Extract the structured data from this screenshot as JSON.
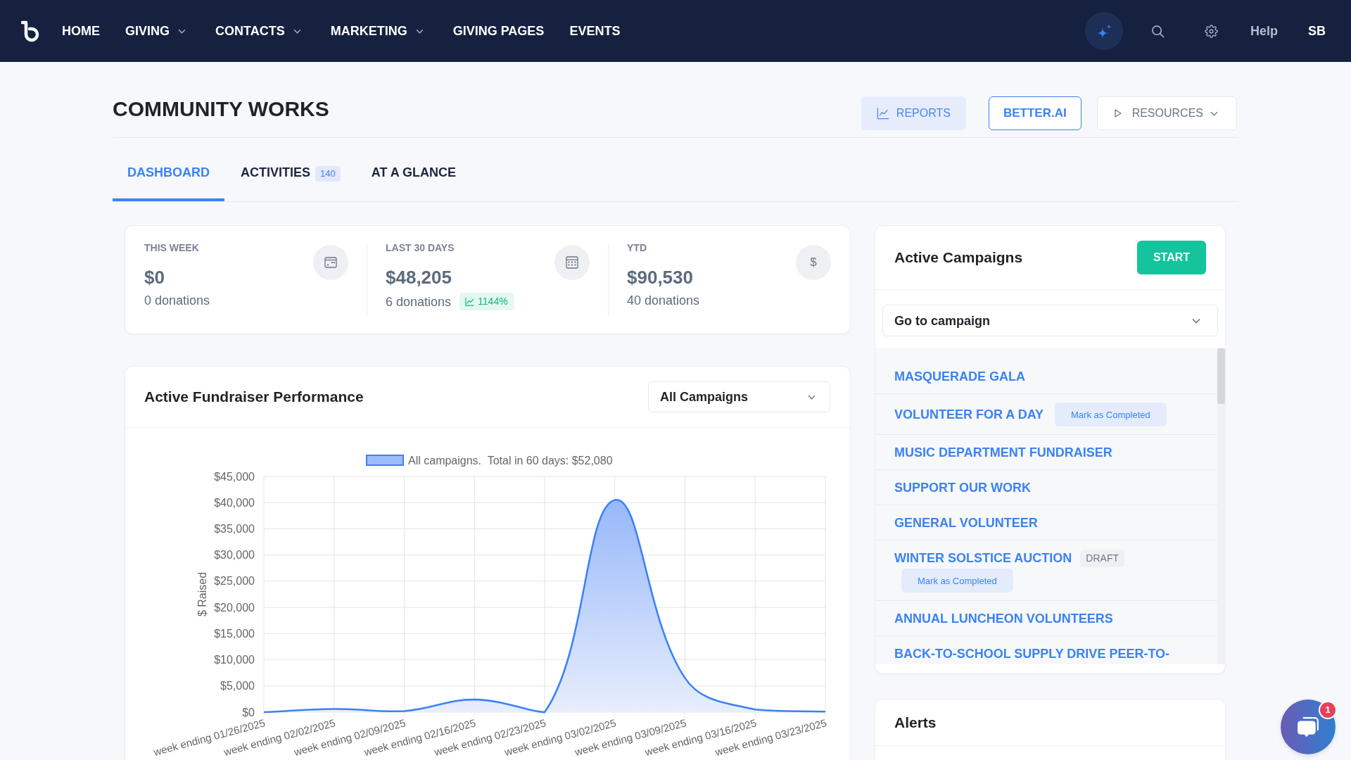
{
  "nav": {
    "items": [
      {
        "label": "HOME",
        "has_menu": false
      },
      {
        "label": "GIVING",
        "has_menu": true
      },
      {
        "label": "CONTACTS",
        "has_menu": true
      },
      {
        "label": "MARKETING",
        "has_menu": true
      },
      {
        "label": "GIVING PAGES",
        "has_menu": false
      },
      {
        "label": "EVENTS",
        "has_menu": false
      }
    ],
    "help": "Help",
    "user": "SB"
  },
  "header": {
    "title": "COMMUNITY WORKS",
    "actions": [
      {
        "label": "REPORTS",
        "kind": "reports"
      },
      {
        "label": "BETTER.AI",
        "kind": "outline"
      },
      {
        "label": "RESOURCES",
        "kind": "resources"
      }
    ]
  },
  "tabs": [
    {
      "label": "DASHBOARD",
      "selected": true
    },
    {
      "label": "ACTIVITIES",
      "count": "140",
      "selected": false
    },
    {
      "label": "AT A GLANCE",
      "selected": false
    }
  ],
  "stats": [
    {
      "label": "THIS WEEK",
      "value": "$0",
      "detail": "0 donations",
      "kind": "week"
    },
    {
      "label": "LAST 30 DAYS",
      "value": "$48,205",
      "detail": "6 donations",
      "change": "1144%",
      "kind": "month"
    },
    {
      "label": "YTD",
      "value": "$90,530",
      "detail": "40 donations",
      "kind": "symbol",
      "symbol": "$"
    }
  ],
  "performance": {
    "title": "Active Fundraiser Performance",
    "filter": "All Campaigns",
    "chart_data": {
      "type": "area",
      "ylabel": "$ Raised",
      "categories": [
        "week ending 01/26/2025",
        "week ending 02/02/2025",
        "week ending 02/09/2025",
        "week ending 02/16/2025",
        "week ending 02/23/2025",
        "week ending 03/02/2025",
        "week ending 03/09/2025",
        "week ending 03/16/2025",
        "week ending 03/23/2025"
      ],
      "series": [
        {
          "name": "All campaigns.  Total in 60 days: $52,080",
          "color": "#3b82f6",
          "values": [
            0,
            600,
            200,
            2400,
            0,
            40500,
            6500,
            500,
            100
          ]
        }
      ],
      "ylim": [
        0,
        45000
      ],
      "yticks": [
        {
          "value": 0,
          "label": "$0"
        },
        {
          "value": 5000,
          "label": "$5,000"
        },
        {
          "value": 10000,
          "label": "$10,000"
        },
        {
          "value": 15000,
          "label": "$15,000"
        },
        {
          "value": 20000,
          "label": "$20,000"
        },
        {
          "value": 25000,
          "label": "$25,000"
        },
        {
          "value": 30000,
          "label": "$30,000"
        },
        {
          "value": 35000,
          "label": "$35,000"
        },
        {
          "value": 40000,
          "label": "$40,000"
        },
        {
          "value": 45000,
          "label": "$45,000"
        }
      ],
      "grid": true
    }
  },
  "campaigns": {
    "title": "Active Campaigns",
    "start": "START",
    "goto": "Go to campaign",
    "items": [
      {
        "name": "MASQUERADE GALA"
      },
      {
        "name": "VOLUNTEER FOR A DAY",
        "action": "Mark as Completed"
      },
      {
        "name": "MUSIC DEPARTMENT FUNDRAISER"
      },
      {
        "name": "SUPPORT OUR WORK"
      },
      {
        "name": "GENERAL VOLUNTEER"
      },
      {
        "name": "WINTER SOLSTICE AUCTION",
        "status": "DRAFT",
        "action": "Mark as Completed"
      },
      {
        "name": "ANNUAL LUNCHEON VOLUNTEERS"
      },
      {
        "name": "BACK-TO-SCHOOL SUPPLY DRIVE PEER-TO-"
      }
    ]
  },
  "alerts": {
    "title": "Alerts"
  },
  "chat": {
    "unread": "1"
  }
}
